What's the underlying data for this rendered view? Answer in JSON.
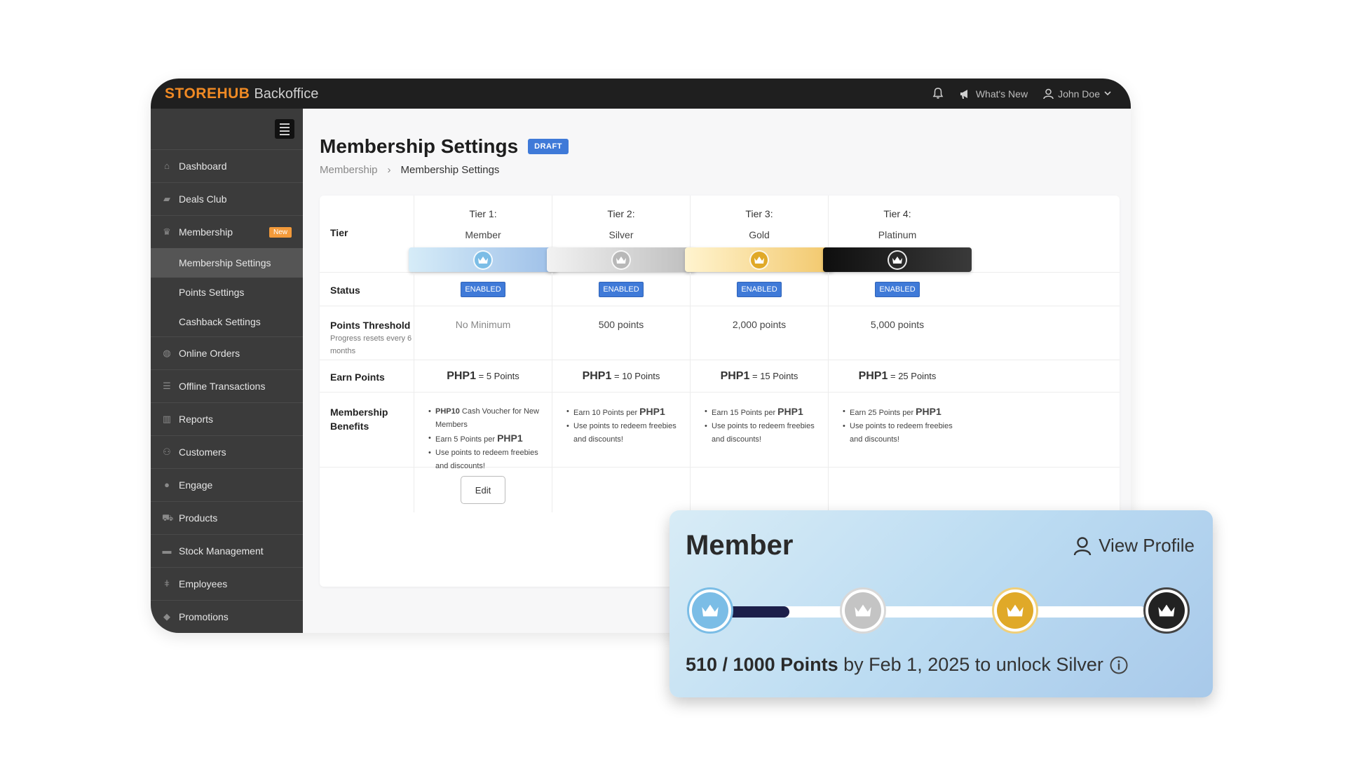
{
  "topbar": {
    "brand_logo": "STOREHUB",
    "brand_sub": "Backoffice",
    "whats_new": "What's New",
    "user": "John Doe"
  },
  "sidebar": {
    "items": [
      {
        "label": "Dashboard",
        "icon": "home-icon"
      },
      {
        "label": "Deals Club",
        "icon": "bag-icon"
      },
      {
        "label": "Membership",
        "icon": "crown-icon",
        "badge": "New"
      },
      {
        "label": "Online Orders",
        "icon": "globe-icon"
      },
      {
        "label": "Offline Transactions",
        "icon": "list-icon"
      },
      {
        "label": "Reports",
        "icon": "chart-icon"
      },
      {
        "label": "Customers",
        "icon": "users-icon"
      },
      {
        "label": "Engage",
        "icon": "chat-icon"
      },
      {
        "label": "Products",
        "icon": "cart-icon"
      },
      {
        "label": "Stock Management",
        "icon": "box-icon"
      },
      {
        "label": "Employees",
        "icon": "person-icon"
      },
      {
        "label": "Promotions",
        "icon": "tag-icon"
      }
    ],
    "sub_items": [
      "Membership Settings",
      "Points Settings",
      "Cashback Settings"
    ],
    "active_sub": "Membership Settings"
  },
  "page": {
    "title": "Membership Settings",
    "status_badge": "DRAFT",
    "breadcrumb": [
      "Membership",
      "Membership Settings"
    ]
  },
  "table": {
    "row_labels": {
      "tier": "Tier",
      "status": "Status",
      "threshold": "Points Threshold",
      "threshold_note": "Progress resets every 6 months",
      "earn": "Earn Points",
      "benefits": "Membership Benefits"
    },
    "tiers": [
      {
        "heading": "Tier 1:",
        "name": "Member",
        "status": "ENABLED",
        "threshold": "No Minimum",
        "earn_currency": "PHP1",
        "earn_rate": "= 5 Points",
        "color_from": "#d6ecf8",
        "color_to": "#9dbfe8",
        "crown": "#7bbde6",
        "benefits": [
          {
            "bold": "PHP10",
            "text": " Cash Voucher for New Members"
          },
          {
            "text": "Earn 5 Points per ",
            "bold_after": "PHP1"
          },
          {
            "text": "Use points to redeem freebies and discounts!"
          }
        ],
        "edit_label": "Edit"
      },
      {
        "heading": "Tier 2:",
        "name": "Silver",
        "status": "ENABLED",
        "threshold": "500 points",
        "earn_currency": "PHP1",
        "earn_rate": "= 10 Points",
        "color_from": "#f2f2f2",
        "color_to": "#bdbdbd",
        "crown": "#b8b8b8",
        "benefits": [
          {
            "text": "Earn 10 Points per ",
            "bold_after": "PHP1"
          },
          {
            "text": "Use points to redeem freebies and discounts!"
          }
        ]
      },
      {
        "heading": "Tier 3:",
        "name": "Gold",
        "status": "ENABLED",
        "threshold": "2,000 points",
        "earn_currency": "PHP1",
        "earn_rate": "= 15 Points",
        "color_from": "#fff4cf",
        "color_to": "#f2c76a",
        "crown": "#e0a928",
        "benefits": [
          {
            "text": "Earn 15 Points per ",
            "bold_after": "PHP1"
          },
          {
            "text": "Use points to redeem freebies and discounts!"
          }
        ]
      },
      {
        "heading": "Tier 4:",
        "name": "Platinum",
        "status": "ENABLED",
        "threshold": "5,000 points",
        "earn_currency": "PHP1",
        "earn_rate": "= 25 Points",
        "color_from": "#0e0e0e",
        "color_to": "#3a3a3a",
        "crown": "#2a2a2a",
        "benefits": [
          {
            "text": "Earn 25 Points per ",
            "bold_after": "PHP1"
          },
          {
            "text": "Use points to redeem freebies and discounts!"
          }
        ]
      }
    ]
  },
  "member_card": {
    "title": "Member",
    "view_profile": "View Profile",
    "progress_fraction": 0.51,
    "points_bold": "510 / 1000 Points",
    "points_rest": "by Feb 1, 2025 to unlock Silver",
    "node_colors": [
      "#7bbde6",
      "#c4c4c4",
      "#e0a928",
      "#222222"
    ]
  }
}
